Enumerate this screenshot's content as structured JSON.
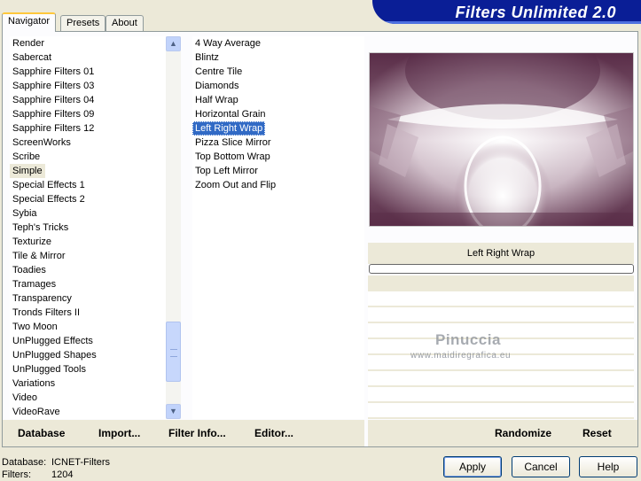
{
  "app": {
    "title": "Filters Unlimited 2.0"
  },
  "tabs": [
    {
      "label": "Navigator",
      "active": true
    },
    {
      "label": "Presets",
      "active": false
    },
    {
      "label": "About",
      "active": false
    }
  ],
  "categories": [
    "Render",
    "Sabercat",
    "Sapphire Filters 01",
    "Sapphire Filters 03",
    "Sapphire Filters 04",
    "Sapphire Filters 09",
    "Sapphire Filters 12",
    "ScreenWorks",
    "Scribe",
    "Simple",
    "Special Effects 1",
    "Special Effects 2",
    "Sybia",
    "Teph's Tricks",
    "Texturize",
    "Tile & Mirror",
    "Toadies",
    "Tramages",
    "Transparency",
    "Tronds Filters II",
    "Two Moon",
    "UnPlugged Effects",
    "UnPlugged Shapes",
    "UnPlugged Tools",
    "Variations",
    "Video",
    "VideoRave"
  ],
  "selected_category": "Simple",
  "filters": [
    "4 Way Average",
    "Blintz",
    "Centre Tile",
    "Diamonds",
    "Half Wrap",
    "Horizontal Grain",
    "Left Right Wrap",
    "Pizza Slice Mirror",
    "Top Bottom Wrap",
    "Top Left Mirror",
    "Zoom Out and Flip"
  ],
  "selected_filter": "Left Right Wrap",
  "preview": {
    "filter_name": "Left Right Wrap"
  },
  "watermark": {
    "line1": "Pinuccia",
    "line2": "www.maidiregrafica.eu"
  },
  "toolbar": {
    "database": "Database",
    "import": "Import...",
    "filter_info": "Filter Info...",
    "editor": "Editor...",
    "randomize": "Randomize",
    "reset": "Reset"
  },
  "status": {
    "database_label": "Database:",
    "database_value": "ICNET-Filters",
    "filters_label": "Filters:",
    "filters_value": "1204"
  },
  "buttons": {
    "apply": "Apply",
    "cancel": "Cancel",
    "help": "Help"
  },
  "colors": {
    "banner": "#0a1e96",
    "selection": "#316ac5",
    "preview_dark": "#5a2d48"
  }
}
